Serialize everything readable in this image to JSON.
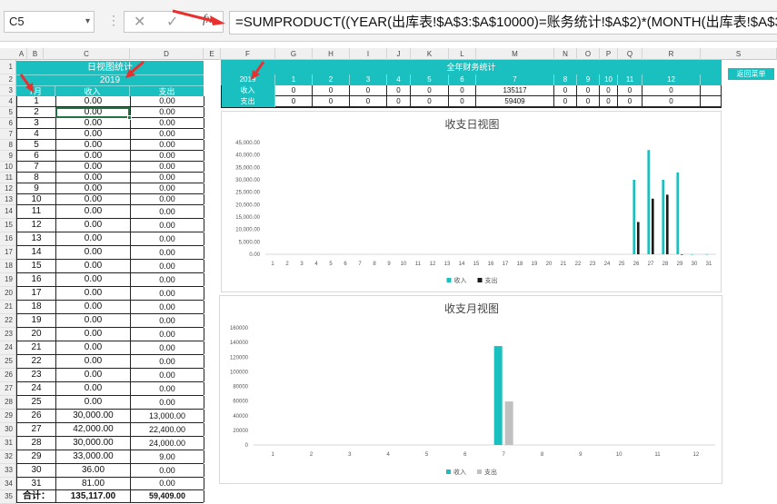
{
  "formula_bar": {
    "name_box": "C5",
    "cancel_icon": "✕",
    "confirm_icon": "✓",
    "fx_label": "fx",
    "formula": "=SUMPRODUCT((YEAR(出库表!$A$3:$A$10000)=账务统计!$A$2)*(MONTH(出库表!$A$3:$A$"
  },
  "columns": [
    "A",
    "B",
    "C",
    "D",
    "E",
    "F",
    "G",
    "H",
    "I",
    "J",
    "K",
    "L",
    "M",
    "N",
    "O",
    "P",
    "Q",
    "R",
    "S"
  ],
  "rows": [
    "1",
    "2",
    "3",
    "4",
    "5",
    "6",
    "7",
    "8",
    "9",
    "10",
    "11",
    "12",
    "13",
    "14",
    "15",
    "16",
    "17",
    "18",
    "19",
    "20",
    "21",
    "22",
    "23",
    "24",
    "25",
    "26",
    "27",
    "28",
    "29",
    "30",
    "31",
    "32",
    "33",
    "34",
    "35"
  ],
  "daily": {
    "title": "日视图统计",
    "year": "2019",
    "month_header": "7月",
    "income_header": "收入",
    "expense_header": "支出",
    "rows": [
      [
        "1",
        "0.00",
        "0.00"
      ],
      [
        "2",
        "0.00",
        "0.00"
      ],
      [
        "3",
        "0.00",
        "0.00"
      ],
      [
        "4",
        "0.00",
        "0.00"
      ],
      [
        "5",
        "0.00",
        "0.00"
      ],
      [
        "6",
        "0.00",
        "0.00"
      ],
      [
        "7",
        "0.00",
        "0.00"
      ],
      [
        "8",
        "0.00",
        "0.00"
      ],
      [
        "9",
        "0.00",
        "0.00"
      ],
      [
        "10",
        "0.00",
        "0.00"
      ],
      [
        "11",
        "0.00",
        "0.00"
      ],
      [
        "12",
        "0.00",
        "0.00"
      ],
      [
        "13",
        "0.00",
        "0.00"
      ],
      [
        "14",
        "0.00",
        "0.00"
      ],
      [
        "15",
        "0.00",
        "0.00"
      ],
      [
        "16",
        "0.00",
        "0.00"
      ],
      [
        "17",
        "0.00",
        "0.00"
      ],
      [
        "18",
        "0.00",
        "0.00"
      ],
      [
        "19",
        "0.00",
        "0.00"
      ],
      [
        "20",
        "0.00",
        "0.00"
      ],
      [
        "21",
        "0.00",
        "0.00"
      ],
      [
        "22",
        "0.00",
        "0.00"
      ],
      [
        "23",
        "0.00",
        "0.00"
      ],
      [
        "24",
        "0.00",
        "0.00"
      ],
      [
        "25",
        "0.00",
        "0.00"
      ],
      [
        "26",
        "30,000.00",
        "13,000.00"
      ],
      [
        "27",
        "42,000.00",
        "22,400.00"
      ],
      [
        "28",
        "30,000.00",
        "24,000.00"
      ],
      [
        "29",
        "33,000.00",
        "9.00"
      ],
      [
        "30",
        "36.00",
        "0.00"
      ],
      [
        "31",
        "81.00",
        "0.00"
      ]
    ],
    "total_label": "合计：",
    "total_income": "135,117.00",
    "total_expense": "59,409.00"
  },
  "yearly": {
    "title": "全年财务统计",
    "year": "2019",
    "months": [
      "1",
      "2",
      "3",
      "4",
      "5",
      "6",
      "7",
      "8",
      "9",
      "10",
      "11",
      "12"
    ],
    "income_label": "收入",
    "expense_label": "支出",
    "income": [
      "0",
      "0",
      "0",
      "0",
      "0",
      "0",
      "135117",
      "0",
      "0",
      "0",
      "0",
      "0"
    ],
    "expense": [
      "0",
      "0",
      "0",
      "0",
      "0",
      "0",
      "59409",
      "0",
      "0",
      "0",
      "0",
      "0"
    ]
  },
  "return_button": "返回菜单",
  "colors": {
    "teal": "#19c0bf",
    "black": "#1a1a1a",
    "gray": "#c0c0c0",
    "selection": "#217346",
    "arrow": "#e8312f"
  },
  "chart_data": [
    {
      "type": "bar",
      "title": "收支日视图",
      "categories": [
        "1",
        "2",
        "3",
        "4",
        "5",
        "6",
        "7",
        "8",
        "9",
        "10",
        "11",
        "12",
        "13",
        "14",
        "15",
        "16",
        "17",
        "18",
        "19",
        "20",
        "21",
        "22",
        "23",
        "24",
        "25",
        "26",
        "27",
        "28",
        "29",
        "30",
        "31"
      ],
      "series": [
        {
          "name": "收入",
          "values": [
            0,
            0,
            0,
            0,
            0,
            0,
            0,
            0,
            0,
            0,
            0,
            0,
            0,
            0,
            0,
            0,
            0,
            0,
            0,
            0,
            0,
            0,
            0,
            0,
            0,
            30000,
            42000,
            30000,
            33000,
            36,
            81
          ]
        },
        {
          "name": "支出",
          "values": [
            0,
            0,
            0,
            0,
            0,
            0,
            0,
            0,
            0,
            0,
            0,
            0,
            0,
            0,
            0,
            0,
            0,
            0,
            0,
            0,
            0,
            0,
            0,
            0,
            0,
            13000,
            22400,
            24000,
            9,
            0,
            0
          ]
        }
      ],
      "ylim": [
        0,
        45000
      ],
      "yticks": [
        "45,000.00",
        "40,000.00",
        "35,000.00",
        "30,000.00",
        "25,000.00",
        "20,000.00",
        "15,000.00",
        "10,000.00",
        "5,000.00",
        "0.00"
      ],
      "legend": "bottom"
    },
    {
      "type": "bar",
      "title": "收支月视图",
      "categories": [
        "1",
        "2",
        "3",
        "4",
        "5",
        "6",
        "7",
        "8",
        "9",
        "10",
        "11",
        "12"
      ],
      "series": [
        {
          "name": "收入",
          "values": [
            0,
            0,
            0,
            0,
            0,
            0,
            135117,
            0,
            0,
            0,
            0,
            0
          ]
        },
        {
          "name": "支出",
          "values": [
            0,
            0,
            0,
            0,
            0,
            0,
            59409,
            0,
            0,
            0,
            0,
            0
          ]
        }
      ],
      "ylim": [
        0,
        160000
      ],
      "yticks": [
        "160000",
        "140000",
        "120000",
        "100000",
        "80000",
        "60000",
        "40000",
        "20000",
        "0"
      ],
      "legend": "bottom"
    }
  ]
}
